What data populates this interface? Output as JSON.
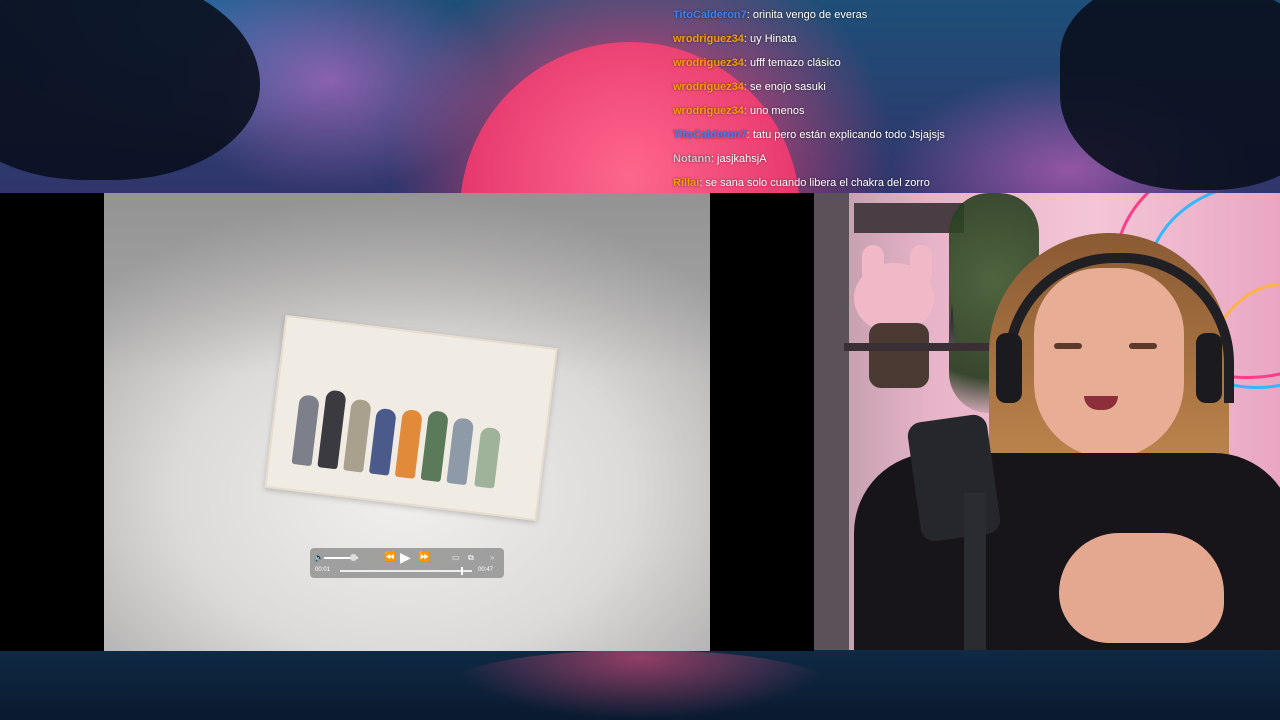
{
  "chat": {
    "messages": [
      {
        "user": "TitoCalderon7",
        "color": "#3b82f6",
        "text": ": orinita vengo de everas"
      },
      {
        "user": "wrodriguez34",
        "color": "#f59e0b",
        "text": ": uy Hinata"
      },
      {
        "user": "wrodriguez34",
        "color": "#f59e0b",
        "text": ": ufff temazo clásico"
      },
      {
        "user": "wrodriguez34",
        "color": "#f59e0b",
        "text": ": se enojo sasuki"
      },
      {
        "user": "wrodriguez34",
        "color": "#f59e0b",
        "text": ": uno menos"
      },
      {
        "user": "TitoCalderon7",
        "color": "#3b82f6",
        "text": ": tatu pero están explicando todo Jsjajsjs"
      },
      {
        "user": "Notann",
        "color": "#c7c7c7",
        "text": ": jasjkahsjA"
      },
      {
        "user": "Rillai",
        "color": "#f59e0b",
        "text": ": se sana solo cuando libera el chakra del zorro"
      }
    ]
  },
  "player": {
    "volume_fraction": 0.85,
    "time_elapsed": "00:01",
    "time_remaining": "00:47",
    "progress_fraction": 0.92,
    "icons": [
      "volume-icon",
      "rewind-icon",
      "play-icon",
      "fast-forward-icon",
      "airplay-icon",
      "pip-icon",
      "more-icon"
    ]
  },
  "colors": {
    "accent_pink": "#f23b70",
    "background_dark": "#0b1022"
  }
}
